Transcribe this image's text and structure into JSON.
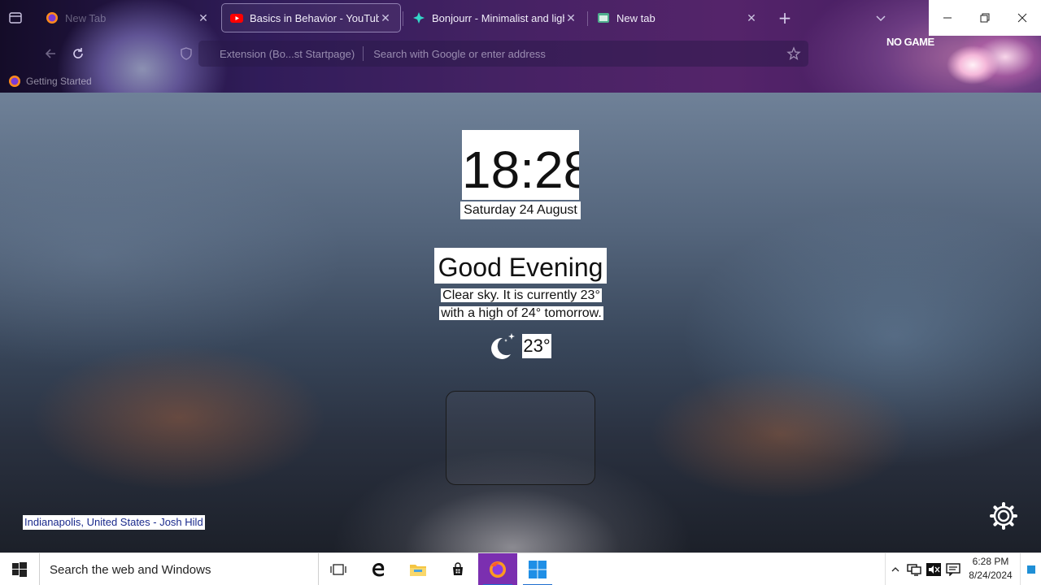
{
  "browser": {
    "tabs": [
      {
        "title": "New Tab",
        "favicon": "firefox-icon",
        "active": false
      },
      {
        "title": "Basics in Behavior - YouTube",
        "favicon": "youtube-icon",
        "active": true
      },
      {
        "title": "Bonjourr - Minimalist and lightweight startpage",
        "favicon": "bonjourr-icon",
        "active": false
      },
      {
        "title": "New tab",
        "favicon": "newtab-icon",
        "active": false
      }
    ],
    "urlbar": {
      "extension_chip": "Extension (Bo...st Startpage)",
      "placeholder": "Search with Google or enter address"
    },
    "bookmarks": [
      {
        "label": "Getting Started",
        "icon": "firefox-icon"
      }
    ],
    "theme_badge": "NO GAME"
  },
  "startpage": {
    "time": "18:28",
    "date": "Saturday 24 August",
    "greeting": "Good Evening",
    "description_line1": "Clear sky. It is currently 23°",
    "description_line2": "with a high of 24° tomorrow.",
    "weather_icon": "moon-stars-icon",
    "temperature": "23°",
    "credit": "Indianapolis, United States - Josh Hild"
  },
  "taskbar": {
    "search_placeholder": "Search the web and Windows",
    "clock_time": "6:28 PM",
    "clock_date": "8/24/2024"
  },
  "colors": {
    "accent_taskbar_active": "#7b2fb0",
    "windows_blue": "#1f6fd0"
  }
}
